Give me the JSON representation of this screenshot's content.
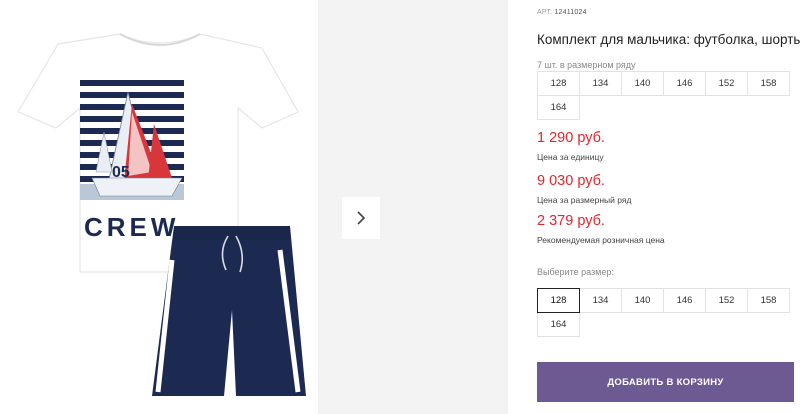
{
  "product": {
    "sku_label": "АРТ.",
    "sku": "12411024",
    "title": "Комплект для мальчика: футболка, шорты",
    "print_text": "CREW",
    "print_number": "05"
  },
  "pack": {
    "note": "7 шт. в размерном ряду",
    "sizes": [
      "128",
      "134",
      "140",
      "146",
      "152",
      "158",
      "164"
    ]
  },
  "prices": [
    {
      "value": "1 290 руб.",
      "label": "Цена за единицу"
    },
    {
      "value": "9 030 руб.",
      "label": "Цена за размерный ряд"
    },
    {
      "value": "2 379 руб.",
      "label": "Рекомендуемая розничная цена"
    }
  ],
  "size_select": {
    "label": "Выберите размер:",
    "selected": "128",
    "sizes": [
      "128",
      "134",
      "140",
      "146",
      "152",
      "158",
      "164"
    ]
  },
  "cart_button": {
    "label": "ДОБАВИТЬ В КОРЗИНУ"
  },
  "colors": {
    "price_red": "#e2262d",
    "button_purple": "#6e5a93",
    "navy": "#1c2a52"
  },
  "icons": {
    "next": "chevron-right-icon"
  }
}
